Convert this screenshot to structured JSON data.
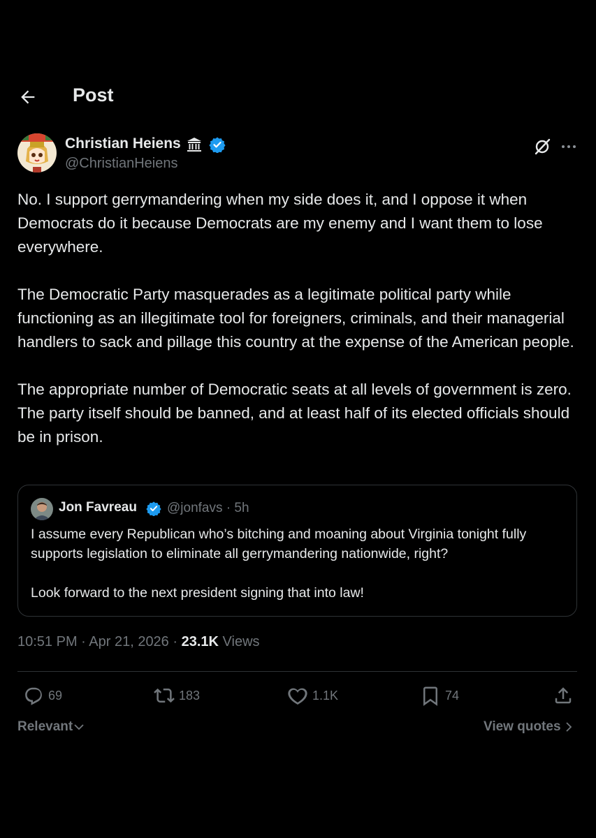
{
  "header": {
    "title": "Post",
    "back_icon": "arrow-left-icon"
  },
  "post": {
    "author_name": "Christian Heiens",
    "author_handle": "@ChristianHeiens",
    "badges": [
      "classical-building-icon",
      "verified-badge-icon"
    ],
    "paragraphs": [
      "No. I support gerrymandering when my side does it, and I oppose it when Democrats do it because Democrats are my enemy and I want them to lose everywhere.",
      "The Democratic Party masquerades as a legitimate political party while functioning as an illegitimate tool for foreigners, criminals, and their managerial handlers to sack and pillage this country at the expense of the American people.",
      "The appropriate number of Democratic seats at all levels of government is zero. The party itself should be banned, and at least half of its elected officials should be in prison."
    ],
    "quote": {
      "author_name": "Jon Favreau",
      "meta": "@jonfavs · 5h",
      "paragraphs": [
        "I assume every Republican who’s bitching and moaning about Virginia tonight fully supports legislation to eliminate all gerrymandering nationwide, right?",
        "Look forward to the next president signing that into law!"
      ]
    },
    "timestamp": "10:51 PM · Apr 21, 2026 · ",
    "views_count": "23.1K",
    "views_label": " Views"
  },
  "actions": {
    "replies": "69",
    "reposts": "183",
    "likes": "1.1K",
    "bookmarks": "74"
  },
  "footer": {
    "relevant": "Relevant",
    "view_quotes": "View quotes"
  },
  "colors": {
    "background": "#000000",
    "text": "#e7e9ea",
    "muted": "#71767b",
    "border": "#2f3336",
    "verified": "#1d9bf0"
  }
}
